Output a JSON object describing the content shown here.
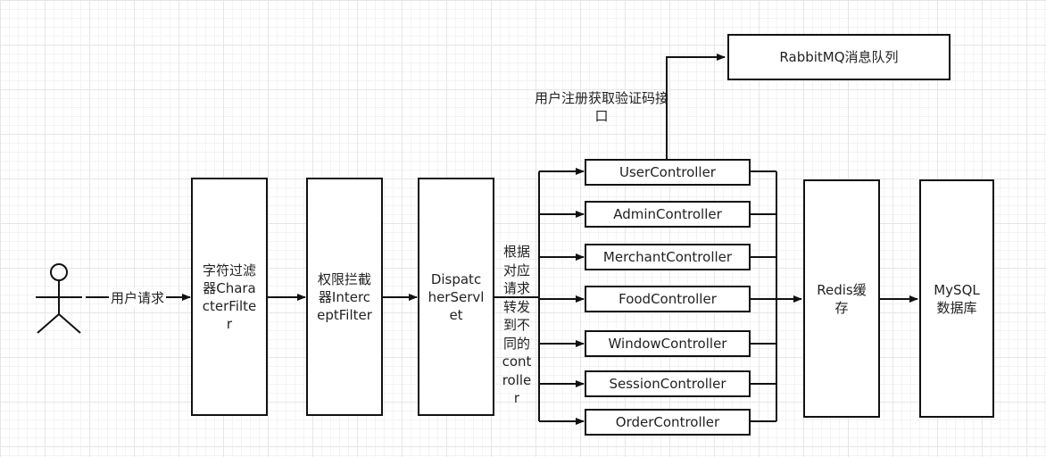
{
  "diagram": {
    "actor_label": "用户请求",
    "filters": {
      "char_filter": "字符过滤器CharacterFilter",
      "auth_interceptor": "权限拦截器InterceptFilter",
      "dispatcher": "DispatcherServlet"
    },
    "dispatch_label": "根据对应请求转发到不同的controller",
    "controllers": [
      "UserController",
      "AdminController",
      "MerchantController",
      "FoodController",
      "WindowController",
      "SessionController",
      "OrderController"
    ],
    "mq_label": "用户注册获取验证码接口",
    "rabbitmq": "RabbitMQ消息队列",
    "redis": "Redis缓存",
    "mysql": "MySQL数据库"
  }
}
